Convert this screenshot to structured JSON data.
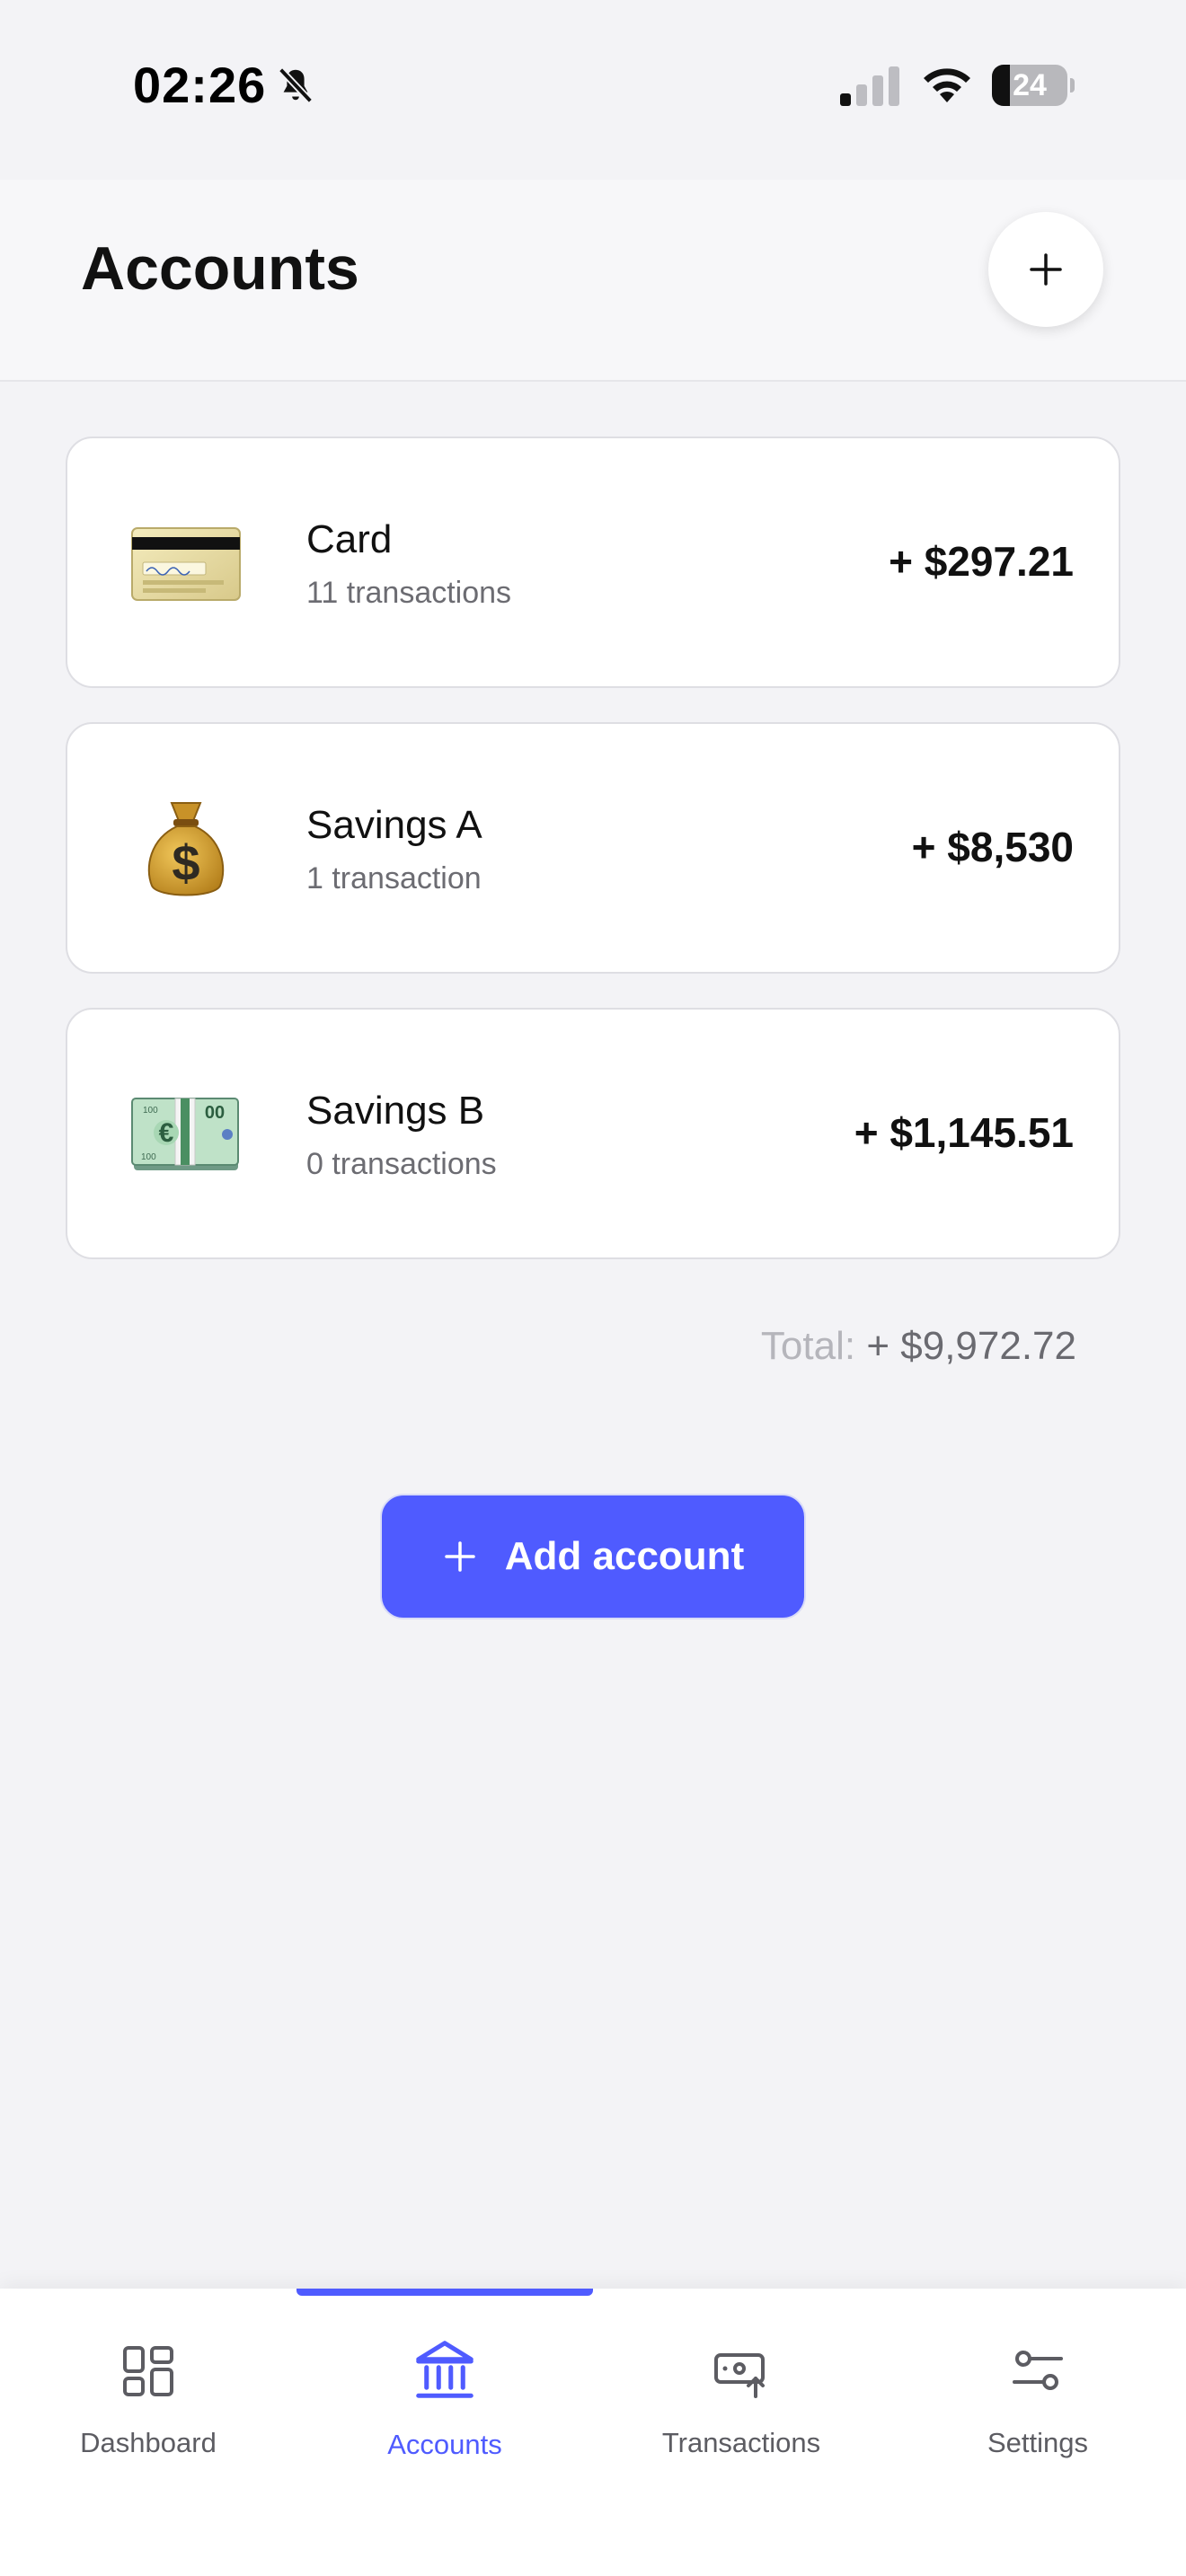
{
  "status_bar": {
    "time": "02:26",
    "battery_level": "24",
    "battery_fraction": 0.24,
    "icons": [
      "bell-slash-icon",
      "cellular-signal-icon",
      "wifi-icon",
      "battery-icon"
    ]
  },
  "header": {
    "title": "Accounts",
    "add_icon": "plus-icon"
  },
  "accounts": [
    {
      "name": "Card",
      "subtitle": "11 transactions",
      "amount": "+ $297.21",
      "icon": "credit-card-icon"
    },
    {
      "name": "Savings A",
      "subtitle": "1 transaction",
      "amount": "+ $8,530",
      "icon": "money-bag-icon"
    },
    {
      "name": "Savings B",
      "subtitle": "0 transactions",
      "amount": "+ $1,145.51",
      "icon": "euro-banknote-icon"
    }
  ],
  "total": {
    "label": "Total:",
    "value": "+ $9,972.72"
  },
  "add_account_button": {
    "label": "Add account",
    "icon": "plus-icon"
  },
  "tab_bar": {
    "active": "Accounts",
    "tabs": [
      {
        "label": "Dashboard",
        "icon": "dashboard-grid-icon"
      },
      {
        "label": "Accounts",
        "icon": "bank-icon"
      },
      {
        "label": "Transactions",
        "icon": "money-transfer-icon"
      },
      {
        "label": "Settings",
        "icon": "sliders-icon"
      }
    ]
  },
  "colors": {
    "accent": "#4f5bff",
    "background": "#f3f3f6",
    "card": "#ffffff",
    "muted_text": "#6c6c72"
  }
}
